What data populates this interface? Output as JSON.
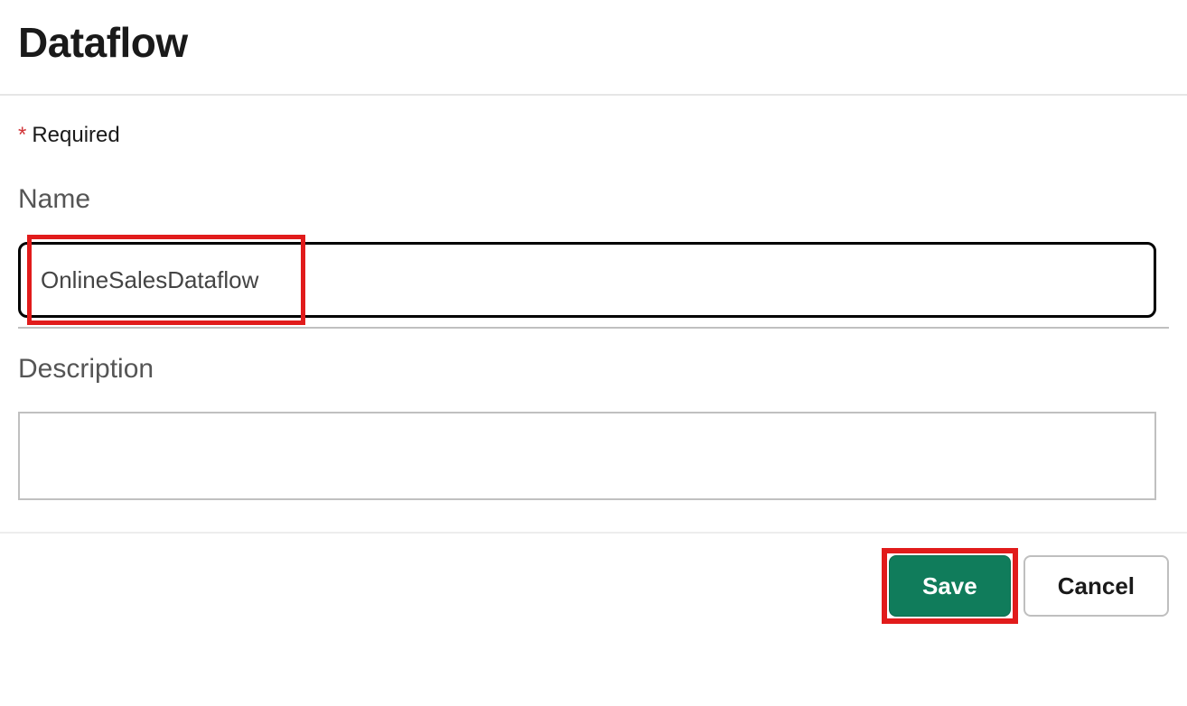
{
  "panel": {
    "title": "Dataflow",
    "required_asterisk": "*",
    "required_label": "Required",
    "fields": {
      "name": {
        "label": "Name",
        "value": "OnlineSalesDataflow"
      },
      "description": {
        "label": "Description",
        "value": ""
      }
    }
  },
  "buttons": {
    "save": "Save",
    "cancel": "Cancel"
  }
}
